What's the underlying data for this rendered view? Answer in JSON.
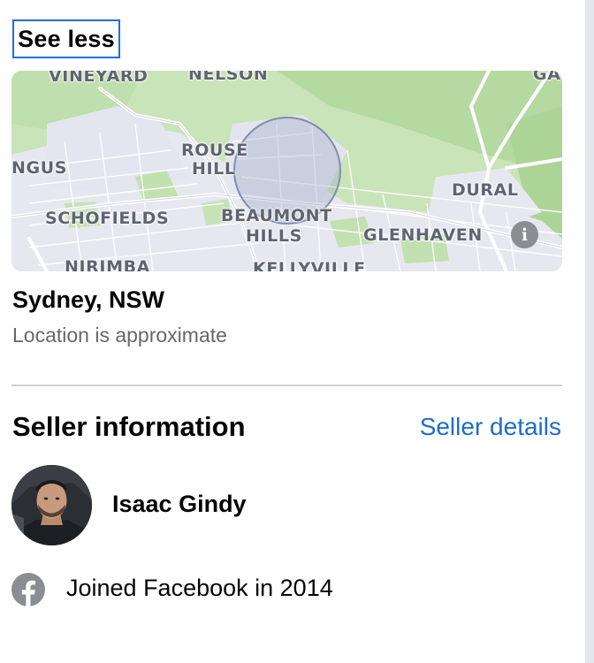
{
  "toggle": {
    "label": "See less",
    "focus_color": "#1b6ee8"
  },
  "map": {
    "labels": {
      "vineyard": "VINEYARD",
      "nelson": "NELSON",
      "ga": "GA",
      "rouse_hill_1": "ROUSE",
      "rouse_hill_2": "HILL",
      "angus": "NGUS",
      "dural": "DURAL",
      "schofields": "SCHOFIELDS",
      "beaumont_hills_1": "BEAUMONT",
      "beaumont_hills_2": "HILLS",
      "glenhaven": "GLENHAVEN",
      "nirimba": "NIRIMBA",
      "kellyville": "KELLYVILLE"
    },
    "info_icon": "info-icon",
    "info_glyph": "i",
    "colors": {
      "park": "#b4d9a1",
      "urban": "#e8eaf2",
      "road": "#ffffff",
      "radius_fill": "#9aa7c4"
    }
  },
  "location": {
    "title": "Sydney, NSW",
    "subtitle": "Location is approximate"
  },
  "seller": {
    "heading": "Seller information",
    "details_link": "Seller details",
    "name": "Isaac Gindy",
    "joined_text": "Joined Facebook in 2014",
    "link_color": "#1b6ec9"
  }
}
